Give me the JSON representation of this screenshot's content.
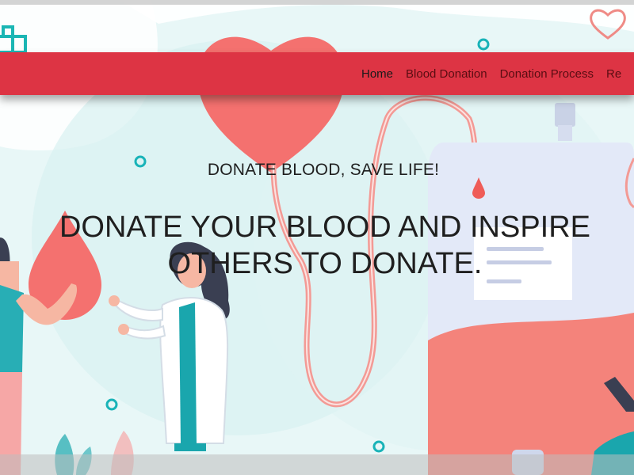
{
  "nav": {
    "items": [
      {
        "label": "Home",
        "active": true
      },
      {
        "label": "Blood Donation",
        "active": false
      },
      {
        "label": "Donation Process",
        "active": false
      },
      {
        "label": "Re",
        "active": false
      }
    ]
  },
  "hero": {
    "tagline": "DONATE BLOOD, SAVE LIFE!",
    "headline": "DONATE YOUR BLOOD AND INSPIRE OTHERS TO DONATE."
  },
  "colors": {
    "nav_bg": "#dd3444",
    "nav_text": "#5a0d12",
    "nav_active": "#1a1a1a",
    "hero_bg": "#e7f6f6",
    "accent_teal": "#10b3b9",
    "blood_red": "#f2716f"
  },
  "icons": [
    "medical-cross-icon",
    "heart-outline-icon",
    "blood-drop-icon"
  ]
}
